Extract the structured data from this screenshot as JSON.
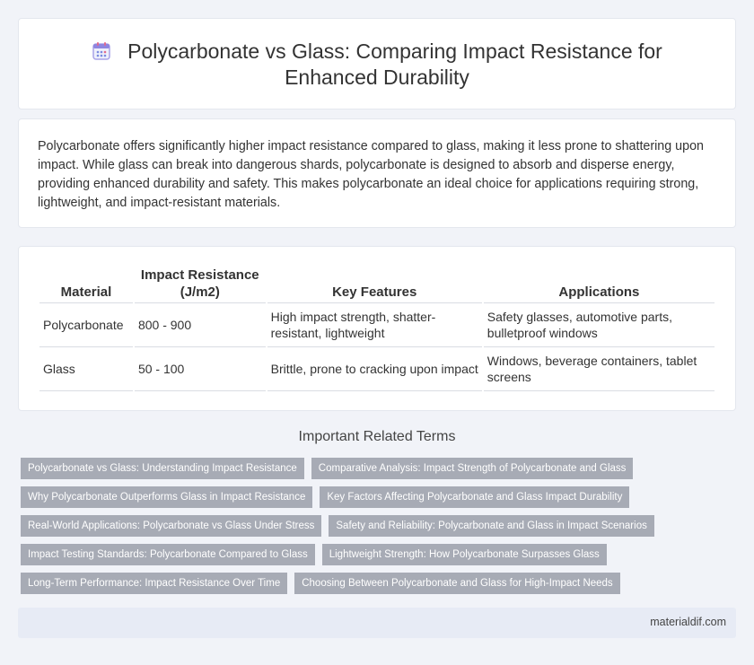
{
  "header": {
    "title_line1": "Polycarbonate vs Glass: Comparing Impact Resistance for",
    "title_line2": "Enhanced Durability",
    "icon": "calendar-icon"
  },
  "intro": {
    "text": "Polycarbonate offers significantly higher impact resistance compared to glass, making it less prone to shattering upon impact. While glass can break into dangerous shards, polycarbonate is designed to absorb and disperse energy, providing enhanced durability and safety. This makes polycarbonate an ideal choice for applications requiring strong, lightweight, and impact-resistant materials."
  },
  "table": {
    "headers": [
      "Material",
      "Impact Resistance (J/m2)",
      "Key Features",
      "Applications"
    ],
    "rows": [
      [
        "Polycarbonate",
        "800 - 900",
        "High impact strength, shatter-resistant, lightweight",
        "Safety glasses, automotive parts, bulletproof windows"
      ],
      [
        "Glass",
        "50 - 100",
        "Brittle, prone to cracking upon impact",
        "Windows, beverage containers, tablet screens"
      ]
    ]
  },
  "related": {
    "title": "Important Related Terms",
    "tags": [
      [
        "Polycarbonate vs Glass: Understanding Impact Resistance",
        "Comparative Analysis: Impact Strength of Polycarbonate and Glass"
      ],
      [
        "Why Polycarbonate Outperforms Glass in Impact Resistance",
        "Key Factors Affecting Polycarbonate and Glass Impact Durability"
      ],
      [
        "Real-World Applications: Polycarbonate vs Glass Under Stress",
        "Safety and Reliability: Polycarbonate and Glass in Impact Scenarios"
      ],
      [
        "Impact Testing Standards: Polycarbonate Compared to Glass",
        "Lightweight Strength: How Polycarbonate Surpasses Glass"
      ],
      [
        "Long-Term Performance: Impact Resistance Over Time",
        "Choosing Between Polycarbonate and Glass for High-Impact Needs"
      ]
    ]
  },
  "footer": {
    "site": "materialdif.com"
  },
  "colors": {
    "background": "#f1f3f8",
    "tag": "#a7abb5",
    "footer": "#e7ebf5"
  }
}
